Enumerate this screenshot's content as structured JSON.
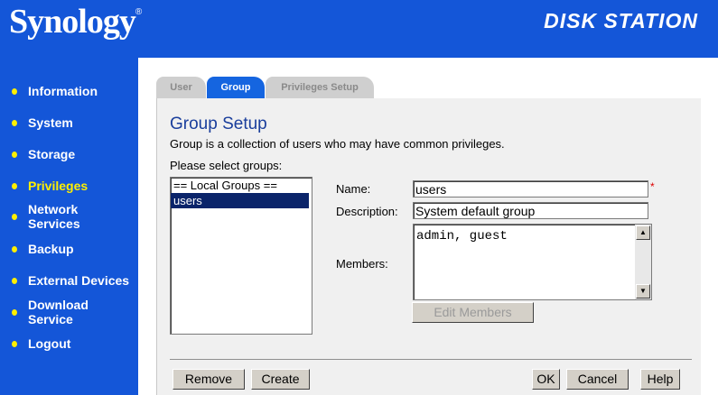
{
  "header": {
    "logo": "Synology",
    "logo_mark": "®",
    "brand": "DISK STATION"
  },
  "sidebar": {
    "items": [
      {
        "label": "Information"
      },
      {
        "label": "System"
      },
      {
        "label": "Storage"
      },
      {
        "label": "Privileges",
        "active": true
      },
      {
        "label_line1": "Network",
        "label_line2": "Services"
      },
      {
        "label": "Backup"
      },
      {
        "label": "External Devices"
      },
      {
        "label_line1": "Download",
        "label_line2": "Service"
      },
      {
        "label": "Logout"
      }
    ]
  },
  "tabs": [
    {
      "label": "User"
    },
    {
      "label": "Group",
      "active": true
    },
    {
      "label": "Privileges Setup"
    }
  ],
  "group_setup": {
    "title": "Group Setup",
    "description": "Group is a collection of users who may have common privileges.",
    "select_label": "Please select groups:",
    "groups": [
      "== Local Groups ==",
      "users"
    ],
    "selected_group": "users",
    "name_label": "Name:",
    "name_value": "users",
    "required_mark": "*",
    "description_label": "Description:",
    "description_value": "System default group",
    "members_label": "Members:",
    "members_value": "admin, guest",
    "edit_members_button": "Edit Members"
  },
  "buttons": {
    "remove": "Remove",
    "create": "Create",
    "ok": "OK",
    "cancel": "Cancel",
    "help": "Help"
  },
  "colors": {
    "brand_blue": "#1456d8",
    "active_tab": "#1565e0",
    "highlight_yellow": "#ffef00",
    "selection": "#0a246a",
    "title_blue": "#1a3e9c"
  },
  "icons": {
    "bullet": "bullet-dot-icon",
    "scroll_up": "scroll-up-arrow-icon",
    "scroll_down": "scroll-down-arrow-icon"
  }
}
